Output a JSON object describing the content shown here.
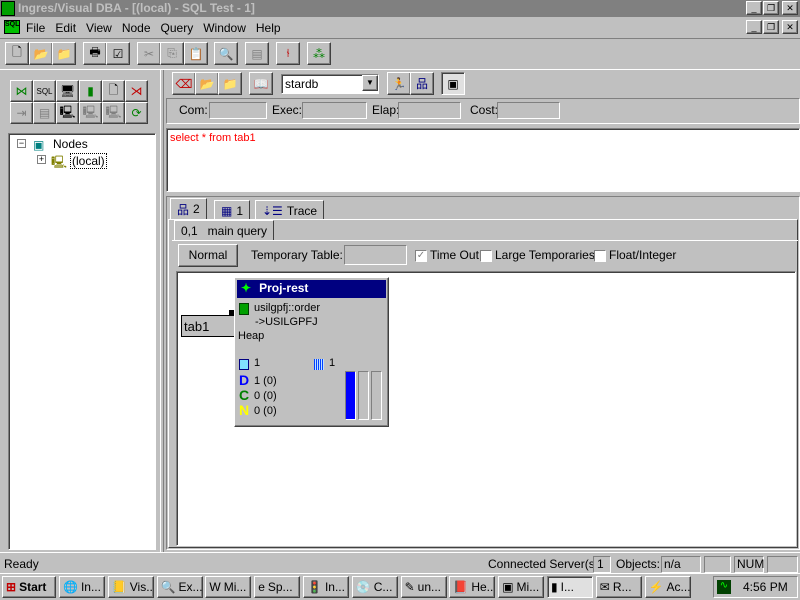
{
  "window": {
    "title": "Ingres/Visual DBA - [(local) - SQL Test - 1]"
  },
  "menu": [
    "File",
    "Edit",
    "View",
    "Node",
    "Query",
    "Window",
    "Help"
  ],
  "tree": {
    "root": "Nodes",
    "child": "(local)"
  },
  "sql_toolbar": {
    "database": "stardb"
  },
  "stats": {
    "com_label": "Com:",
    "exec_label": "Exec:",
    "elap_label": "Elap:",
    "cost_label": "Cost:"
  },
  "query_text": "select * from tab1",
  "tabs": [
    {
      "label": "2"
    },
    {
      "label": "1"
    },
    {
      "label": "Trace"
    }
  ],
  "subtab": "0,1   main query",
  "options": {
    "normal_button": "Normal",
    "temp_table_label": "Temporary Table:",
    "timeout": "Time Out",
    "large_temps": "Large Temporaries",
    "float_int": "Float/Integer"
  },
  "plan": {
    "table_node": "tab1",
    "node_title": "Proj-rest",
    "line1": "usilgpfj::order",
    "line2": "->USILGPFJ",
    "storage": "Heap",
    "pages": "1",
    "tuples": "1",
    "d_label": "D",
    "d_value": "1  (0)",
    "c_label": "C",
    "c_value": "0  (0)",
    "n_label": "N",
    "n_value": "0  (0)",
    "bar_fill": 1.0
  },
  "status": {
    "text": "Ready",
    "servers_label": "Connected Server(s):",
    "servers": "1",
    "objects_label": "Objects:",
    "objects": "n/a",
    "num": "NUM"
  },
  "taskbar": {
    "start": "Start",
    "items": [
      "In...",
      "Vis...",
      "Ex...",
      "Mi...",
      "Sp...",
      "In...",
      "C...",
      "un...",
      "He...",
      "Mi...",
      "I...",
      "R...",
      "Ac..."
    ],
    "clock": "4:56 PM"
  },
  "colors": {
    "title_inactive": "#808080",
    "node_header": "#000080",
    "bar": "#0000ff"
  }
}
